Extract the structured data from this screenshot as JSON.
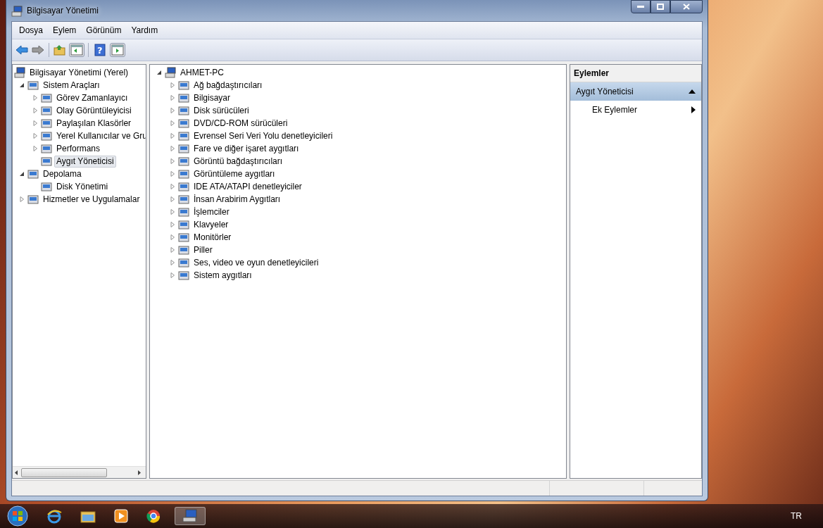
{
  "window": {
    "title": "Bilgisayar Yönetimi"
  },
  "menu": [
    "Dosya",
    "Eylem",
    "Görünüm",
    "Yardım"
  ],
  "toolbar": {
    "help_icon": "?"
  },
  "tree": [
    {
      "label": "Bilgisayar Yönetimi (Yerel)",
      "kind": "root",
      "selected": false,
      "children": [
        {
          "label": "Sistem Araçları",
          "kind": "group",
          "expanded": true,
          "selected": false,
          "children": [
            {
              "label": "Görev Zamanlayıcı",
              "kind": "group",
              "expanded": false,
              "selected": false
            },
            {
              "label": "Olay Görüntüleyicisi",
              "kind": "group",
              "expanded": false,
              "selected": false
            },
            {
              "label": "Paylaşılan Klasörler",
              "kind": "group",
              "expanded": false,
              "selected": false
            },
            {
              "label": "Yerel Kullanıcılar ve Gru",
              "kind": "group",
              "expanded": false,
              "selected": false
            },
            {
              "label": "Performans",
              "kind": "group",
              "expanded": false,
              "selected": false
            },
            {
              "label": "Aygıt Yöneticisi",
              "kind": "leaf",
              "selected": true
            }
          ]
        },
        {
          "label": "Depolama",
          "kind": "group",
          "expanded": true,
          "selected": false,
          "children": [
            {
              "label": "Disk Yönetimi",
              "kind": "leaf",
              "selected": false
            }
          ]
        },
        {
          "label": "Hizmetler ve Uygulamalar",
          "kind": "group",
          "expanded": false,
          "selected": false
        }
      ]
    }
  ],
  "devices": {
    "label": "AHMET-PC",
    "expanded": true,
    "children": [
      {
        "label": "Ağ bağdaştırıcıları",
        "expanded": false
      },
      {
        "label": "Bilgisayar",
        "expanded": false
      },
      {
        "label": "Disk sürücüleri",
        "expanded": false
      },
      {
        "label": "DVD/CD-ROM sürücüleri",
        "expanded": false
      },
      {
        "label": "Evrensel Seri Veri Yolu denetleyicileri",
        "expanded": false
      },
      {
        "label": "Fare ve diğer işaret aygıtları",
        "expanded": false
      },
      {
        "label": "Görüntü bağdaştırıcıları",
        "expanded": false
      },
      {
        "label": "Görüntüleme aygıtları",
        "expanded": false
      },
      {
        "label": "IDE ATA/ATAPI denetleyiciler",
        "expanded": false
      },
      {
        "label": "İnsan Arabirim Aygıtları",
        "expanded": false
      },
      {
        "label": "İşlemciler",
        "expanded": false
      },
      {
        "label": "Klavyeler",
        "expanded": false
      },
      {
        "label": "Monitörler",
        "expanded": false
      },
      {
        "label": "Piller",
        "expanded": false
      },
      {
        "label": "Ses, video ve oyun denetleyicileri",
        "expanded": false
      },
      {
        "label": "Sistem aygıtları",
        "expanded": false
      }
    ]
  },
  "actions": {
    "title": "Eylemler",
    "section": {
      "label": "Aygıt Yöneticisi",
      "expanded": true,
      "items": [
        "Ek Eylemler"
      ]
    }
  },
  "taskbar": {
    "language": "TR"
  }
}
